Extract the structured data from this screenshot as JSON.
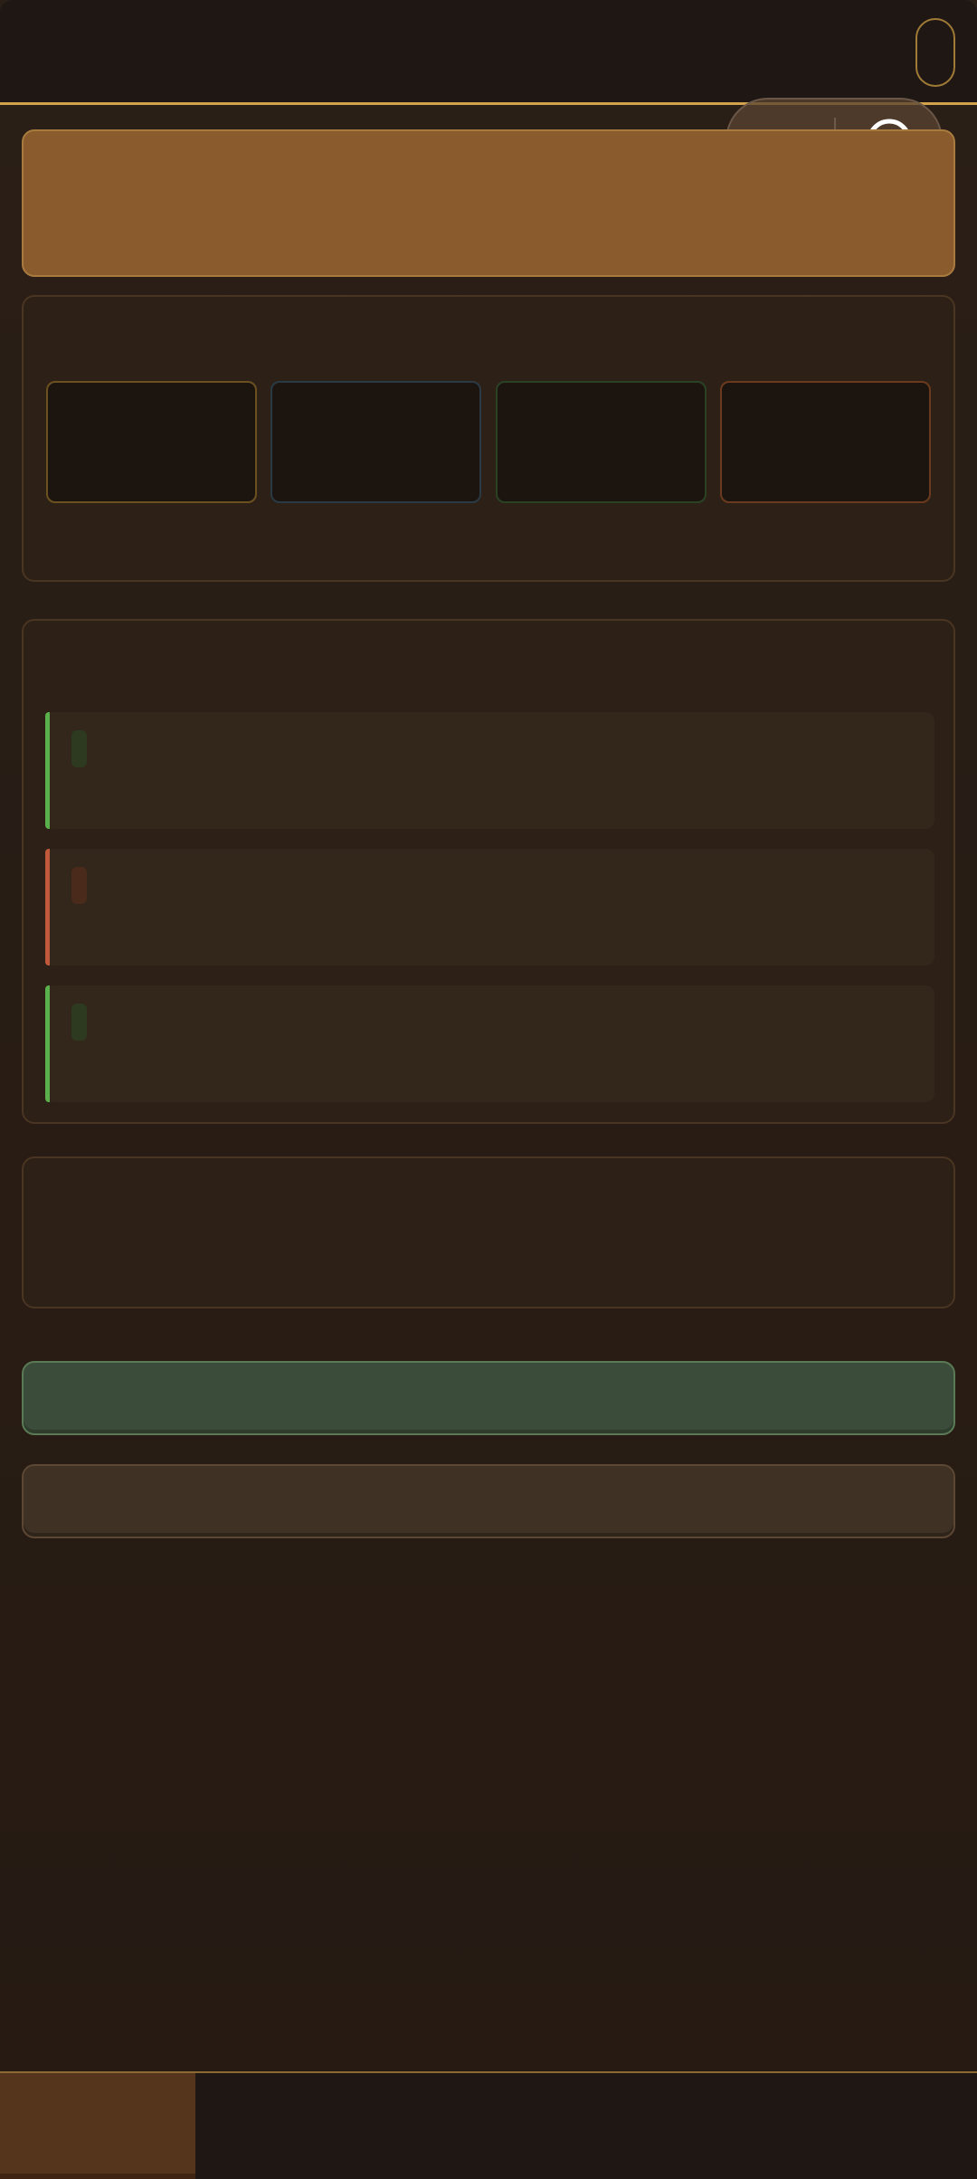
{
  "header": {
    "title": ""
  },
  "banner": {
    "text": ""
  },
  "stats_card": {
    "title": "",
    "items": [
      {
        "value": "",
        "label": "",
        "border_color": "#6b5020",
        "value_color": "#d3a24d"
      },
      {
        "value": "",
        "label": "",
        "border_color": "#2a3a44",
        "value_color": "#8fb6cc"
      },
      {
        "value": "",
        "label": "",
        "border_color": "#2a4224",
        "value_color": "#79b86a"
      },
      {
        "value": "",
        "label": "",
        "border_color": "#6b3a1e",
        "value_color": "#d77a45"
      }
    ]
  },
  "list_card": {
    "title": "",
    "rows": [
      {
        "title": "",
        "subtitle": "",
        "accent": "#5ab04a",
        "tag_color": "#2d3a1f"
      },
      {
        "title": "",
        "subtitle": "",
        "accent": "#c0583c",
        "tag_color": "#4a2a1b"
      },
      {
        "title": "",
        "subtitle": "",
        "accent": "#5ab04a",
        "tag_color": "#2d3a1f"
      }
    ]
  },
  "info_card": {
    "text": ""
  },
  "buttons": {
    "primary_label": "",
    "secondary_label": ""
  },
  "bottom_nav": {
    "active_label": ""
  },
  "colors": {
    "accent_gold": "#d3a24d",
    "banner": "#8a5c2d",
    "primary_button": "#3b4d3a",
    "background": "#2a1f17"
  }
}
